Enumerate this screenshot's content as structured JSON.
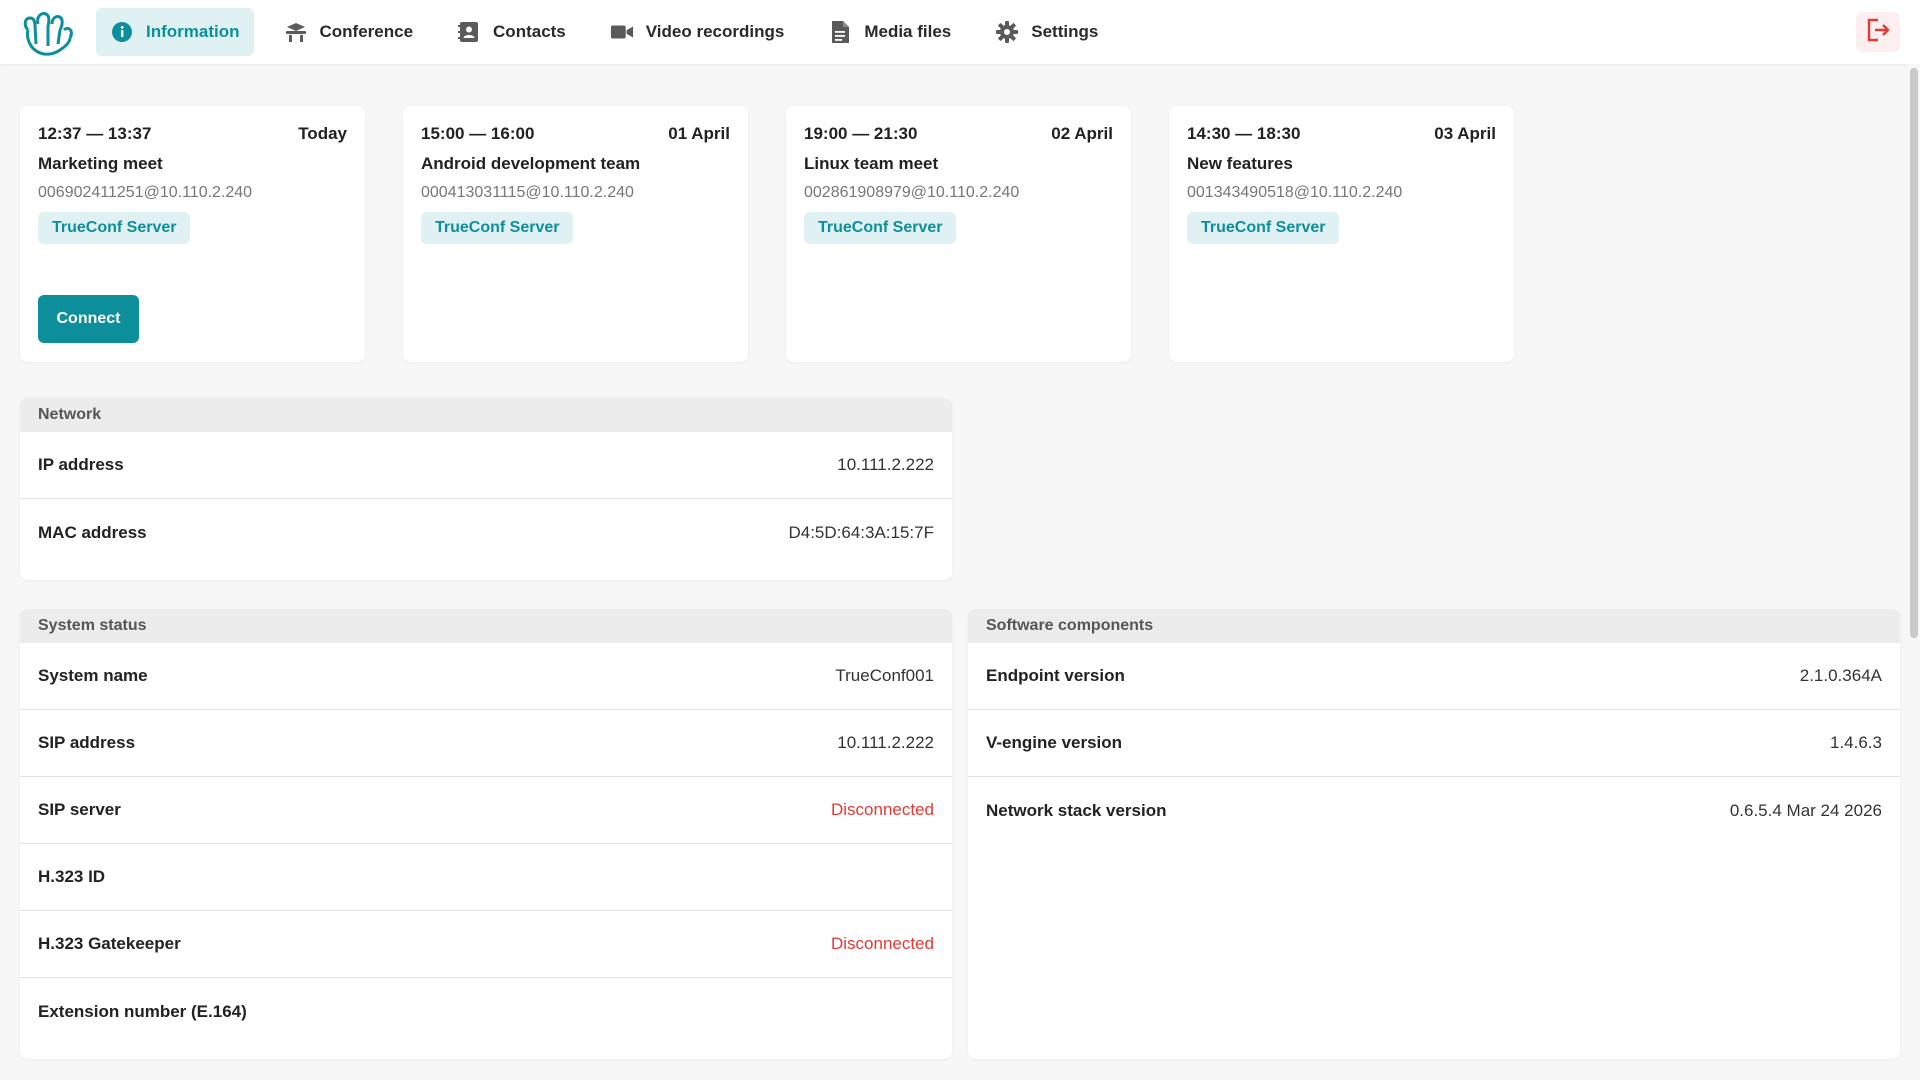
{
  "nav": {
    "items": [
      {
        "label": "Information",
        "icon": "info-icon",
        "active": true
      },
      {
        "label": "Conference",
        "icon": "conference-icon",
        "active": false
      },
      {
        "label": "Contacts",
        "icon": "contacts-icon",
        "active": false
      },
      {
        "label": "Video recordings",
        "icon": "video-camera-icon",
        "active": false
      },
      {
        "label": "Media files",
        "icon": "file-icon",
        "active": false
      },
      {
        "label": "Settings",
        "icon": "gear-icon",
        "active": false
      }
    ]
  },
  "colors": {
    "accent": "#0d8f9b",
    "accent_bg": "#e0f1f3",
    "error": "#e53935"
  },
  "conferences": [
    {
      "time": "12:37 — 13:37",
      "date": "Today",
      "title": "Marketing meet",
      "address": "006902411251@10.110.2.240",
      "server": "TrueConf Server",
      "action": "Connect"
    },
    {
      "time": "15:00 — 16:00",
      "date": "01 April",
      "title": "Android development team",
      "address": "000413031115@10.110.2.240",
      "server": "TrueConf Server"
    },
    {
      "time": "19:00 — 21:30",
      "date": "02 April",
      "title": "Linux team meet",
      "address": "002861908979@10.110.2.240",
      "server": "TrueConf Server"
    },
    {
      "time": "14:30 — 18:30",
      "date": "03 April",
      "title": "New features",
      "address": "001343490518@10.110.2.240",
      "server": "TrueConf Server"
    }
  ],
  "network": {
    "title": "Network",
    "rows": [
      {
        "label": "IP address",
        "value": "10.111.2.222"
      },
      {
        "label": "MAC address",
        "value": "D4:5D:64:3A:15:7F"
      }
    ]
  },
  "system": {
    "title": "System status",
    "rows": [
      {
        "label": "System name",
        "value": "TrueConf001"
      },
      {
        "label": "SIP address",
        "value": "10.111.2.222"
      },
      {
        "label": "SIP server",
        "value": "Disconnected"
      },
      {
        "label": "H.323 ID",
        "value": ""
      },
      {
        "label": "H.323 Gatekeeper",
        "value": "Disconnected"
      },
      {
        "label": "Extension number (E.164)",
        "value": ""
      }
    ]
  },
  "software": {
    "title": "Software components",
    "rows": [
      {
        "label": "Endpoint version",
        "value": "2.1.0.364A"
      },
      {
        "label": "V-engine version",
        "value": "1.4.6.3"
      },
      {
        "label": "Network stack version",
        "value": "0.6.5.4 Mar 24 2026"
      }
    ]
  }
}
